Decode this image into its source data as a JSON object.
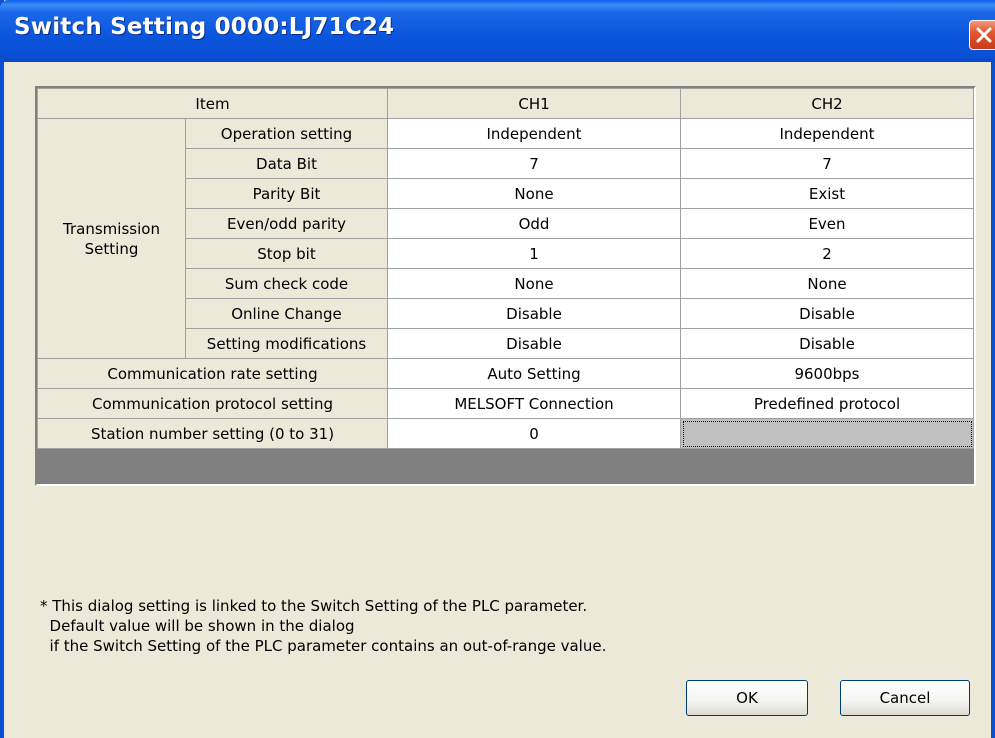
{
  "window": {
    "title": "Switch Setting 0000:LJ71C24",
    "close_icon": "close-icon",
    "colors": {
      "titlebar": "#0a55dc",
      "face": "#ece9d8",
      "close": "#e4572e"
    }
  },
  "table": {
    "headers": {
      "item": "Item",
      "ch1": "CH1",
      "ch2": "CH2"
    },
    "transmission_group_label": "Transmission\nSetting",
    "transmission_rows": [
      {
        "label": "Operation setting",
        "ch1": "Independent",
        "ch2": "Independent"
      },
      {
        "label": "Data Bit",
        "ch1": "7",
        "ch2": "7"
      },
      {
        "label": "Parity Bit",
        "ch1": "None",
        "ch2": "Exist"
      },
      {
        "label": "Even/odd parity",
        "ch1": "Odd",
        "ch2": "Even"
      },
      {
        "label": "Stop bit",
        "ch1": "1",
        "ch2": "2"
      },
      {
        "label": "Sum check code",
        "ch1": "None",
        "ch2": "None"
      },
      {
        "label": "Online Change",
        "ch1": "Disable",
        "ch2": "Disable"
      },
      {
        "label": "Setting modifications",
        "ch1": "Disable",
        "ch2": "Disable"
      }
    ],
    "other_rows": [
      {
        "label": "Communication rate setting",
        "ch1": "Auto Setting",
        "ch2": "9600bps"
      },
      {
        "label": "Communication protocol setting",
        "ch1": "MELSOFT Connection",
        "ch2": "Predefined protocol"
      },
      {
        "label": "Station number setting (0 to 31)",
        "ch1": "0",
        "ch2": ""
      }
    ]
  },
  "note": {
    "line1": "* This dialog setting is linked to the Switch Setting of the PLC parameter.",
    "line2": "  Default value will be shown in the dialog",
    "line3": "  if the Switch Setting of the PLC parameter contains an out-of-range value."
  },
  "buttons": {
    "ok": "OK",
    "cancel": "Cancel"
  }
}
